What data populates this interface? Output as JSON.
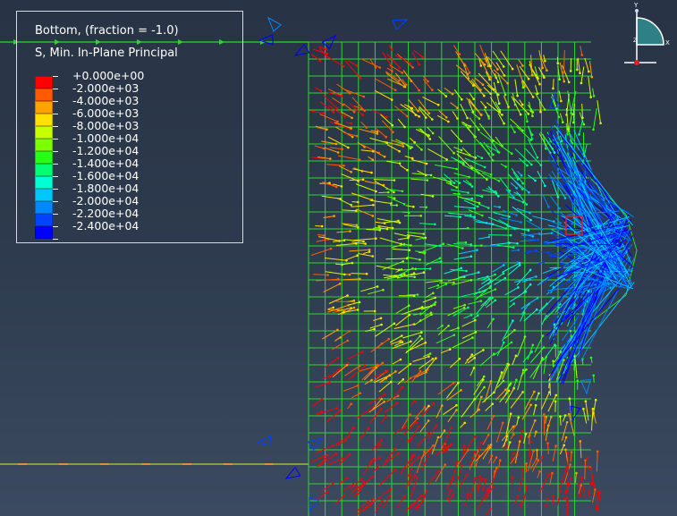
{
  "legend": {
    "section": "Bottom, (fraction = -1.0)",
    "variable": "S, Min. In-Plane Principal",
    "levels": [
      {
        "label": "+0.000e+00",
        "color": "#ff0000"
      },
      {
        "label": "-2.000e+03",
        "color": "#ff5a00"
      },
      {
        "label": "-4.000e+03",
        "color": "#ffa200"
      },
      {
        "label": "-6.000e+03",
        "color": "#ffe000"
      },
      {
        "label": "-8.000e+03",
        "color": "#c8ff00"
      },
      {
        "label": "-1.000e+04",
        "color": "#7cff00"
      },
      {
        "label": "-1.200e+04",
        "color": "#2aff16"
      },
      {
        "label": "-1.400e+04",
        "color": "#00ff73"
      },
      {
        "label": "-1.600e+04",
        "color": "#00ffd2"
      },
      {
        "label": "-1.800e+04",
        "color": "#00c8ff"
      },
      {
        "label": "-2.000e+04",
        "color": "#0088ff"
      },
      {
        "label": "-2.200e+04",
        "color": "#0044ff"
      },
      {
        "label": "-2.400e+04",
        "color": "#0000ff"
      }
    ]
  },
  "triad": {
    "y_label": "Y",
    "x_label": "X",
    "z_label": "Z"
  },
  "colors": {
    "mesh": "#2bd92b",
    "highlight": "#e0202a",
    "triad_fill": "#2f7f86"
  }
}
